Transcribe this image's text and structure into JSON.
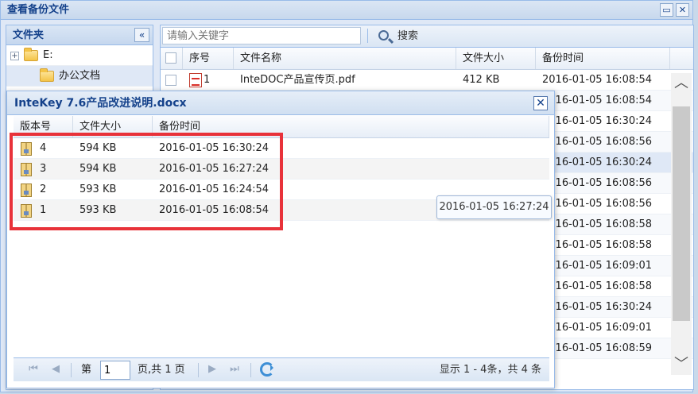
{
  "window": {
    "title": "查看备份文件",
    "restore_icon": "restore-icon",
    "close_icon": "close-icon"
  },
  "folder_panel": {
    "title": "文件夹",
    "collapse_glyph": "«",
    "items": [
      {
        "label": "E:",
        "expander": "+"
      },
      {
        "label": "办公文档"
      }
    ]
  },
  "toolbar": {
    "search_placeholder": "请输入关键字",
    "search_label": "搜索"
  },
  "file_grid": {
    "columns": [
      "序号",
      "文件名称",
      "文件大小",
      "备份时间"
    ],
    "rows": [
      {
        "no": "1",
        "name": "InteDOC产品宣传页.pdf",
        "size": "412 KB",
        "time": "2016-01-05 16:08:54"
      },
      {
        "no": "",
        "name": "",
        "size": "",
        "time": "2016-01-05 16:08:54"
      },
      {
        "no": "",
        "name": "",
        "size": "",
        "time": "2016-01-05 16:30:24"
      },
      {
        "no": "",
        "name": "",
        "size": "",
        "time": "2016-01-05 16:08:56"
      },
      {
        "no": "",
        "name": "",
        "size": "",
        "time": "2016-01-05 16:30:24"
      },
      {
        "no": "",
        "name": "",
        "size": "",
        "time": "2016-01-05 16:08:56"
      },
      {
        "no": "",
        "name": "",
        "size": "",
        "time": "2016-01-05 16:08:56"
      },
      {
        "no": "",
        "name": "",
        "size": "",
        "time": "2016-01-05 16:08:58"
      },
      {
        "no": "",
        "name": "",
        "size": "",
        "time": "2016-01-05 16:08:58"
      },
      {
        "no": "",
        "name": "",
        "size": "",
        "time": "2016-01-05 16:09:01"
      },
      {
        "no": "",
        "name": "",
        "size": "",
        "time": "2016-01-05 16:08:58"
      },
      {
        "no": "",
        "name": "",
        "size": "",
        "time": "2016-01-05 16:30:24"
      },
      {
        "no": "",
        "name": "",
        "size": "",
        "time": "2016-01-05 16:09:01"
      },
      {
        "no": "",
        "name": "",
        "size": "",
        "time": "2016-01-05 16:08:59"
      }
    ]
  },
  "dialog": {
    "title": "InteKey 7.6产品改进说明.docx",
    "close_glyph": "✕",
    "columns": [
      "版本号",
      "文件大小",
      "备份时间"
    ],
    "rows": [
      {
        "version": "4",
        "size": "594 KB",
        "time": "2016-01-05 16:30:24"
      },
      {
        "version": "3",
        "size": "594 KB",
        "time": "2016-01-05 16:27:24"
      },
      {
        "version": "2",
        "size": "593 KB",
        "time": "2016-01-05 16:24:54"
      },
      {
        "version": "1",
        "size": "593 KB",
        "time": "2016-01-05 16:08:54"
      }
    ],
    "pager": {
      "page_prefix": "第",
      "page_value": "1",
      "page_suffix": "页,共 1 页",
      "display": "显示 1 - 4条，共 4 条"
    }
  },
  "tooltip": {
    "text": "2016-01-05 16:27:24"
  },
  "colors": {
    "accent": "#15428b",
    "border": "#99bbe8",
    "highlight_box": "#e8323a"
  }
}
